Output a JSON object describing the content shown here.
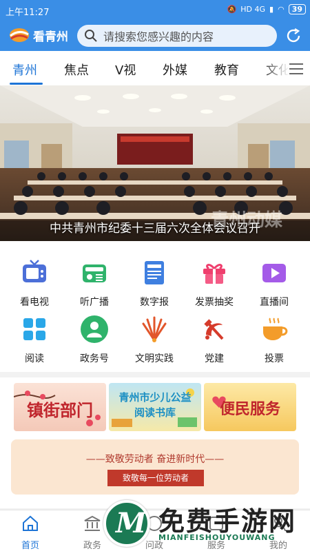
{
  "status": {
    "time": "上午11:27",
    "battery": "39",
    "net": "HD 4G"
  },
  "header": {
    "app_name": "看青州",
    "search_placeholder": "请搜索您感兴趣的内容"
  },
  "tabs": [
    "青州",
    "焦点",
    "V视",
    "外媒",
    "教育",
    "文化"
  ],
  "banner": {
    "caption": "中共青州市纪委十三届六次全体会议召开",
    "watermark": "青州动媒"
  },
  "grid": [
    {
      "label": "看电视",
      "icon": "tv-icon"
    },
    {
      "label": "听广播",
      "icon": "radio-icon"
    },
    {
      "label": "数字报",
      "icon": "newspaper-icon"
    },
    {
      "label": "发票抽奖",
      "icon": "gift-icon"
    },
    {
      "label": "直播间",
      "icon": "live-video-icon"
    },
    {
      "label": "阅读",
      "icon": "reading-grid-icon"
    },
    {
      "label": "政务号",
      "icon": "government-account-icon"
    },
    {
      "label": "文明实践",
      "icon": "civilization-fan-icon"
    },
    {
      "label": "党建",
      "icon": "party-emblem-icon"
    },
    {
      "label": "投票",
      "icon": "coffee-cup-icon"
    }
  ],
  "promo": {
    "cards": [
      "镇街部门",
      "青州市少儿公益阅读书库",
      "便民服务"
    ],
    "labor_title": "——致敬劳动者 奋进新时代——",
    "labor_button": "致敬每一位劳动者"
  },
  "bottom_nav": [
    "首页",
    "政务",
    "问政",
    "服务",
    "我的"
  ],
  "watermark": {
    "title": "免费手游网",
    "subtitle": "MIANFEISHOUYOUWANG"
  },
  "colors": {
    "primary": "#3a8ee6",
    "accent": "#1d74d6",
    "party_red": "#d63b2b"
  }
}
